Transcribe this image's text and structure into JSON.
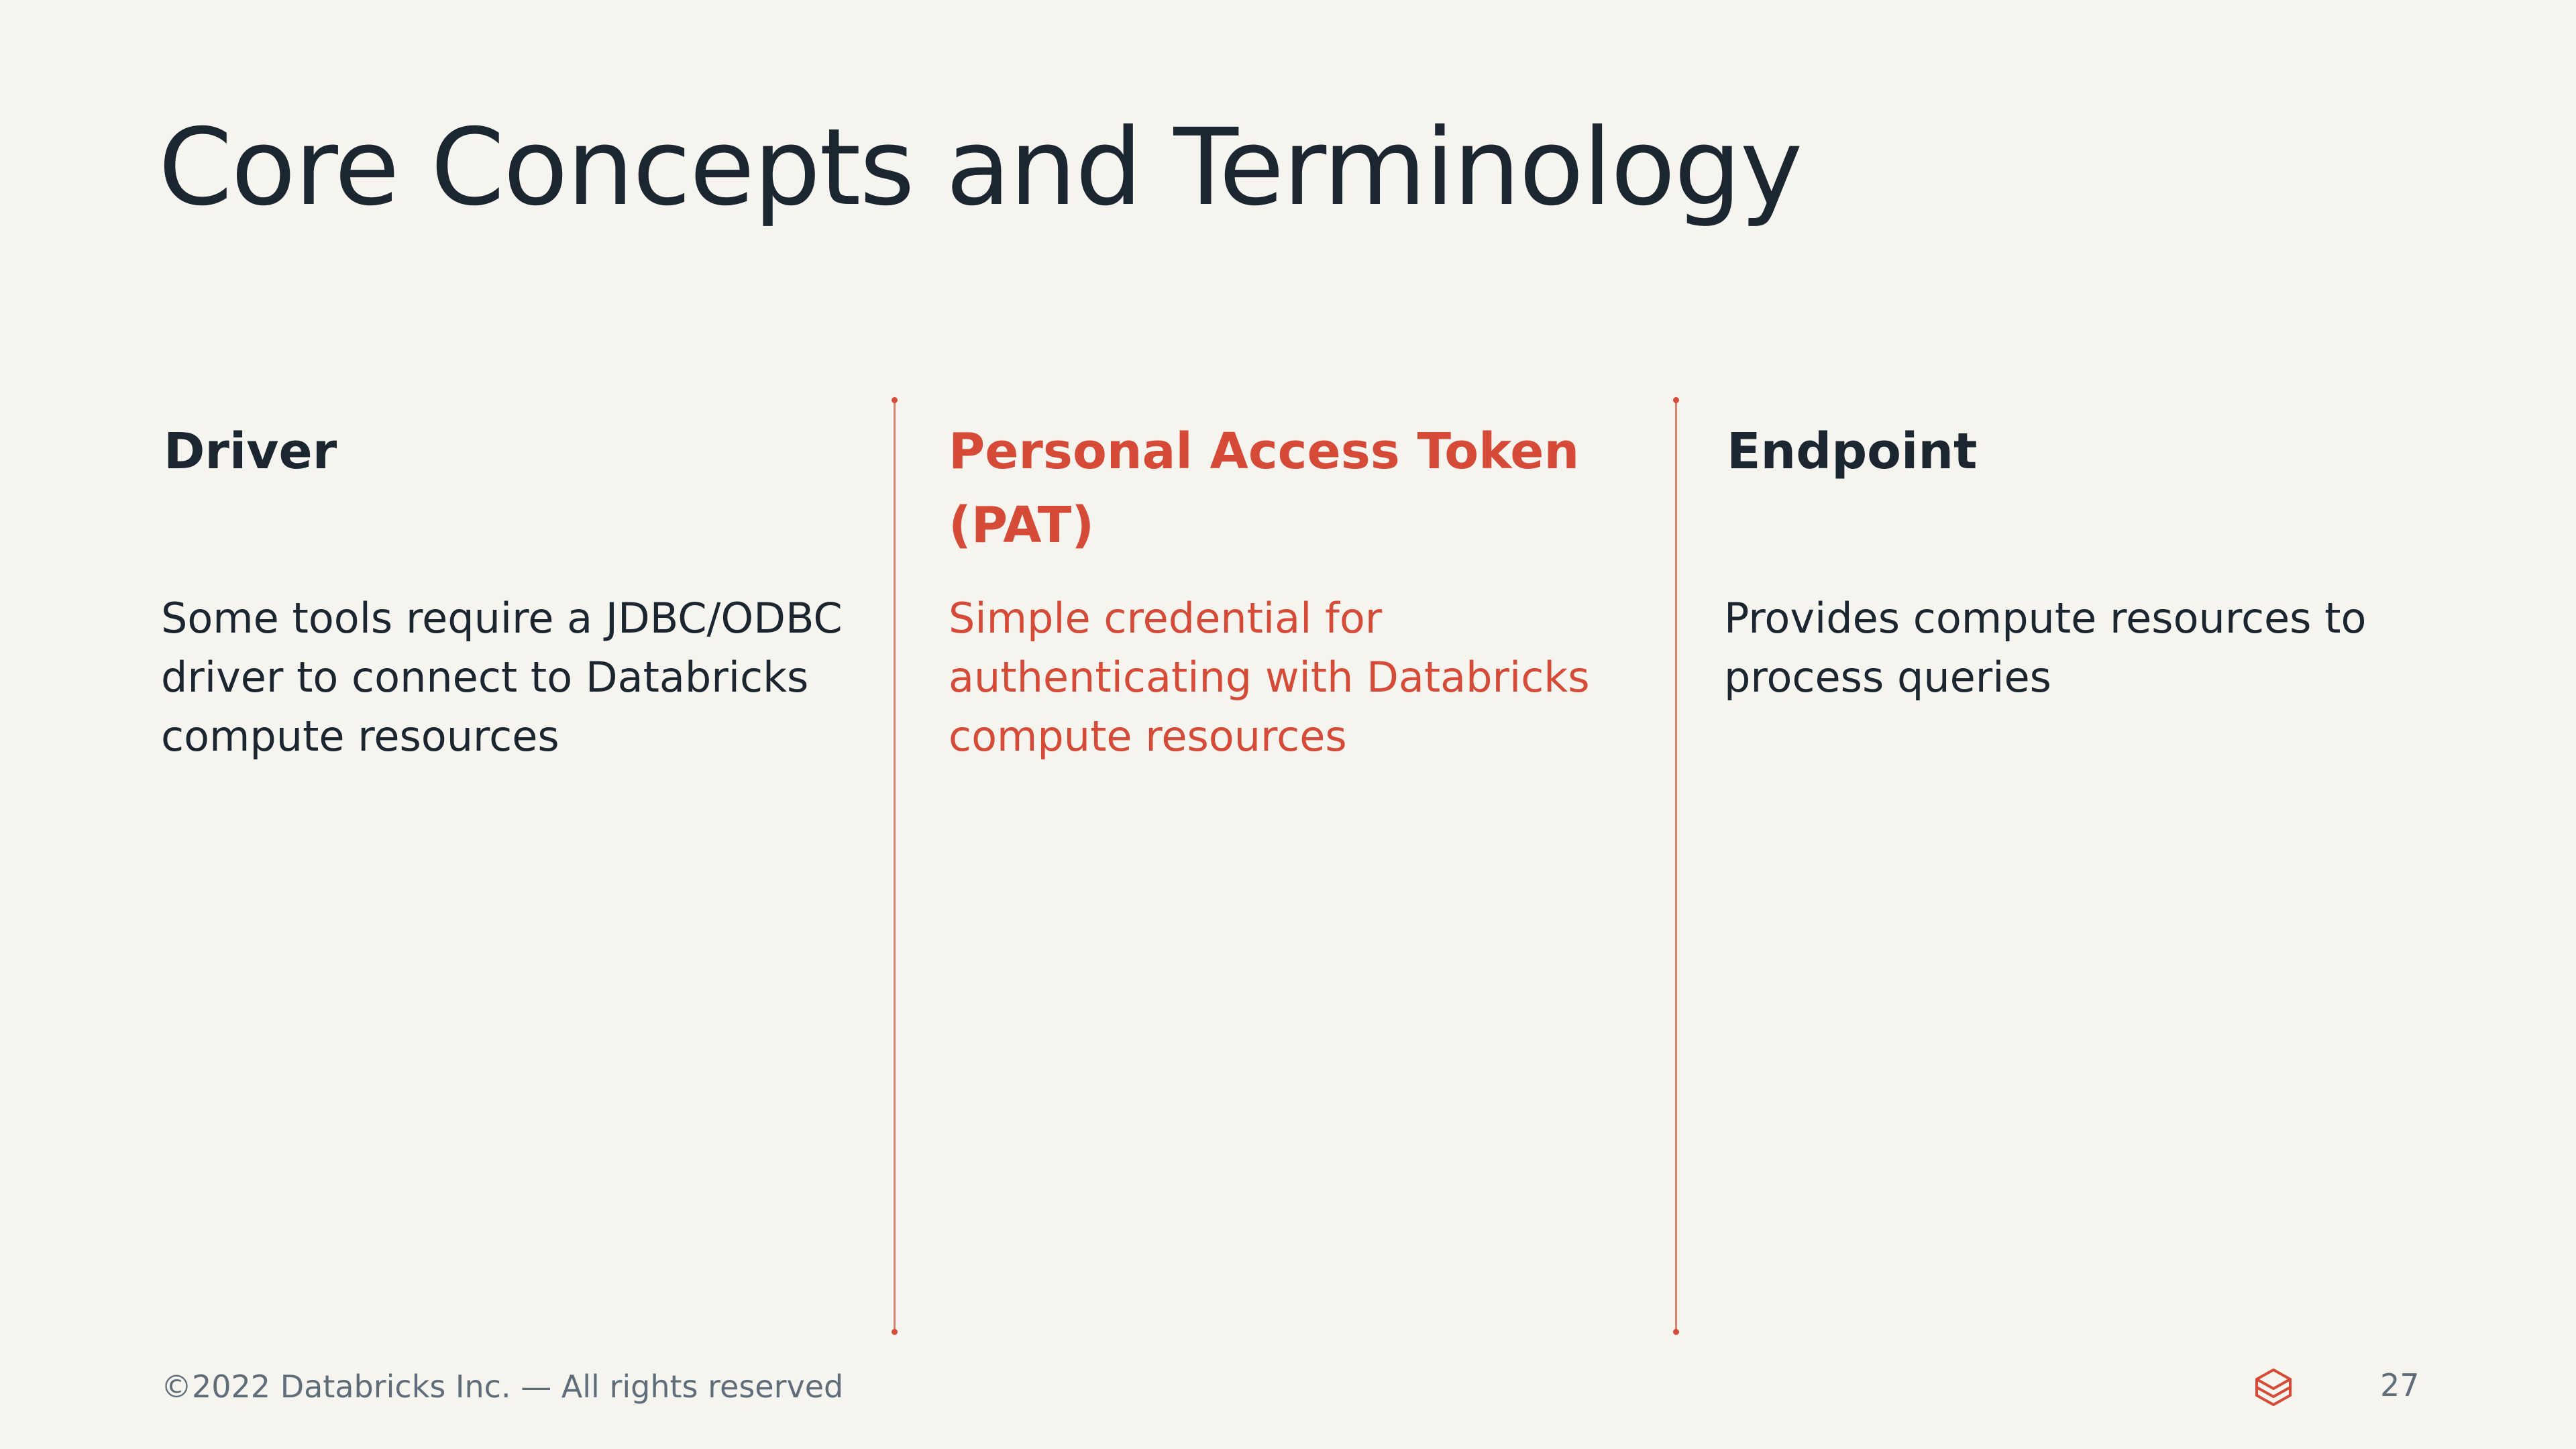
{
  "slide": {
    "title": "Core Concepts and Terminology"
  },
  "columns": [
    {
      "heading": "Driver",
      "heading_lines": [
        "Driver"
      ],
      "body_lines": [
        "Some tools require a JDBC/ODBC",
        "driver to connect to Databricks",
        "compute resources"
      ]
    },
    {
      "heading_lines": [
        "Personal Access Token",
        "(PAT)"
      ],
      "body_lines": [
        "Simple credential for",
        "authenticating with Databricks",
        "compute resources"
      ],
      "highlighted": true
    },
    {
      "heading_lines": [
        "Endpoint"
      ],
      "body_lines": [
        "Provides compute resources to",
        "process queries"
      ]
    }
  ],
  "footer": {
    "copyright": "©2022 Databricks Inc. — All rights reserved",
    "page_number": "27",
    "logo_icon": "databricks-logo-icon"
  },
  "colors": {
    "background": "#f6f4ef",
    "text": "#1b2631",
    "accent": "#d64b38",
    "footer_text": "#5e6d79"
  }
}
